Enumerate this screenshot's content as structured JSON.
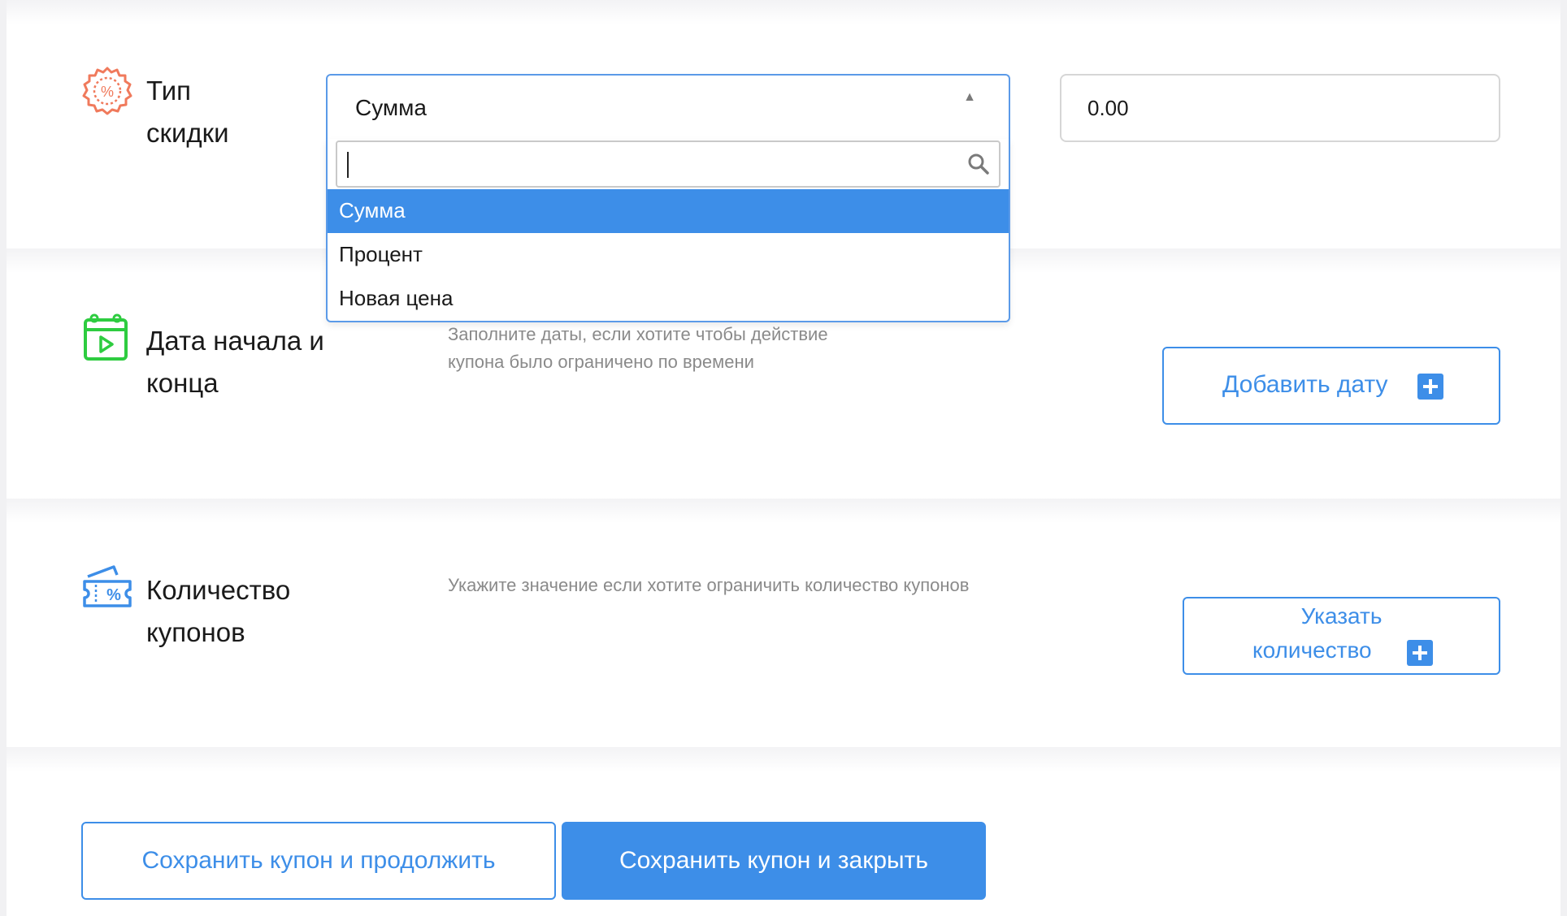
{
  "discount_type": {
    "title_line1": "Тип",
    "title_line2": "скидки",
    "icon": "discount-badge-icon",
    "select": {
      "selected": "Сумма",
      "search_value": "",
      "options": [
        "Сумма",
        "Процент",
        "Новая цена"
      ]
    },
    "amount_value": "0.00"
  },
  "dates": {
    "title_line1": "Дата начала и",
    "title_line2": "конца",
    "icon": "calendar-play-icon",
    "hint_line1": "Заполните даты, если хотите чтобы действие",
    "hint_line2": "купона было ограничено по времени",
    "add_button": "Добавить дату"
  },
  "quantity": {
    "title_line1": "Количество",
    "title_line2": "купонов",
    "icon": "coupon-ticket-icon",
    "hint": "Укажите значение если хотите ограничить количество купонов",
    "button_line1": "Указать",
    "button_line2": "количество"
  },
  "footer": {
    "save_continue": "Сохранить купон и продолжить",
    "save_close": "Сохранить купон и закрыть"
  },
  "colors": {
    "accent": "#3d8ee8",
    "discount_icon": "#f07a5c",
    "calendar_icon": "#2ecc40",
    "coupon_icon": "#3d8ee8",
    "hint_text": "#8a8a8a"
  }
}
